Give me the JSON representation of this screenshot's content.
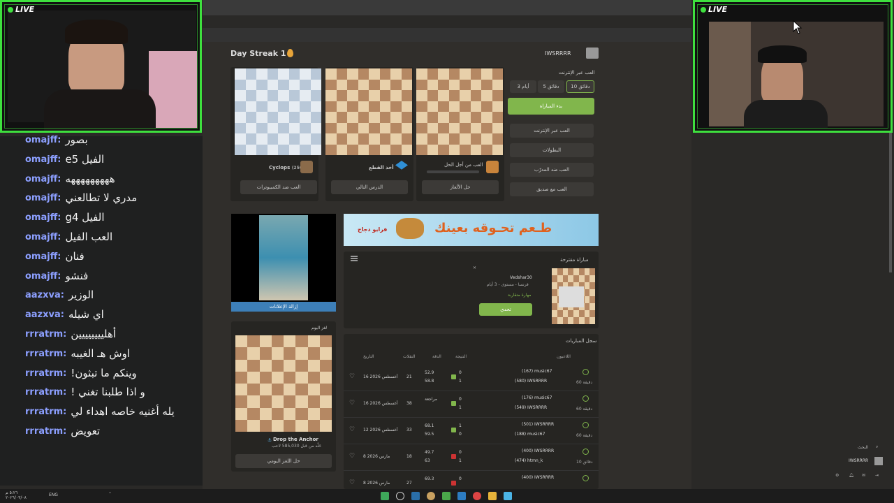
{
  "stream": {
    "live_label": "LIVE"
  },
  "chat": {
    "messages": [
      {
        "user": "omajff",
        "text": "بصور"
      },
      {
        "user": "omajff",
        "text": "e5 الفيل"
      },
      {
        "user": "omajff",
        "text": "هههههههههه"
      },
      {
        "user": "omajff",
        "text": "مدري لا تطالعني"
      },
      {
        "user": "omajff",
        "text": "g4 الفيل"
      },
      {
        "user": "omajff",
        "text": "العب الفيل"
      },
      {
        "user": "omajff",
        "text": "فنان"
      },
      {
        "user": "omajff",
        "text": "فنشو"
      },
      {
        "user": "aazxva",
        "text": "الوزير"
      },
      {
        "user": "aazxva",
        "text": "اي شيله"
      },
      {
        "user": "rrratrm",
        "text": "أهليييييييين"
      },
      {
        "user": "rrratrm",
        "text": "اوش هـ الغيبه"
      },
      {
        "user": "rrratrm",
        "text": "!وينكم ما تبثون"
      },
      {
        "user": "rrratrm",
        "text": "! و اذا طلبنا تغني"
      },
      {
        "user": "rrratrm",
        "text": "يله أغنيه خاصه اهداء لي"
      },
      {
        "user": "rrratrm",
        "text": "تعويض"
      }
    ]
  },
  "site": {
    "streak": "Day Streak 1",
    "username": "IWSRRRR",
    "play_online_title": "العب عبر الإنترنت",
    "time_options": [
      "3 أيام",
      "5 دقائق",
      "10 دقائق"
    ],
    "start_game": "بدء المباراة",
    "menu": [
      "العب عبر الإنترنت",
      "البطولات",
      "العب ضد المدرّب",
      "العب مع صديق"
    ],
    "cards": [
      {
        "title": "Cyclops",
        "rating": "(250)",
        "button": "العب ضد الكمبيوترات"
      },
      {
        "title": "أخذ القطع",
        "button": "الدرس التالي"
      },
      {
        "title": "العب من أجل الحل",
        "button": "حل الألغاز"
      }
    ],
    "ad_remove": "إزالة الإعلانات",
    "ad_text": "طـعم تحـوقه بعينك",
    "ad_brand": "فرايو دجاج",
    "suggested_title": "مباراة مقترحة",
    "suggested_player": "Vedshar30",
    "suggested_info": "فرنسا - مستوى - 3 أيام",
    "suggested_level": "مهارة متقاربة",
    "challenge": "تحدي",
    "puzzle_title": "لغز اليوم",
    "puzzle_name": "Drop the Anchor",
    "puzzle_sub": "حَلّه من قبل 585,030 لاعب",
    "puzzle_btn": "حل اللغز اليومي",
    "history_title": "سجل المباريات",
    "history_headers": [
      "اللاعبون",
      "النتيجة",
      "الدقة",
      "النقلات",
      "التاريخ"
    ],
    "games": [
      {
        "p1": "music67",
        "r1": "(167)",
        "p2": "IWSRRRR",
        "r2": "(580)",
        "s1": "0",
        "s2": "1",
        "acc1": "52.9",
        "acc2": "58.8",
        "moves": "21",
        "date": "16 أغسطس 2026",
        "mode": "60 دقيقة",
        "res": "win"
      },
      {
        "p1": "music67",
        "r1": "(176)",
        "p2": "IWSRRRR",
        "r2": "(549)",
        "s1": "0",
        "s2": "1",
        "acc1": "مراجعة",
        "acc2": "",
        "moves": "38",
        "date": "16 أغسطس 2026",
        "mode": "60 دقيقة",
        "res": "win"
      },
      {
        "p1": "IWSRRRR",
        "r1": "(501)",
        "p2": "music67",
        "r2": "(188)",
        "s1": "1",
        "s2": "0",
        "acc1": "68.1",
        "acc2": "59.5",
        "moves": "33",
        "date": "12 أغسطس 2026",
        "mode": "60 دقيقة",
        "res": "win"
      },
      {
        "p1": "IWSRRRR",
        "r1": "(400)",
        "p2": "htmn_k",
        "r2": "(474)",
        "s1": "0",
        "s2": "1",
        "acc1": "49.7",
        "acc2": "63",
        "moves": "18",
        "date": "8 مارس 2026",
        "mode": "10 دقائق",
        "res": "loss"
      },
      {
        "p1": "IWSRRRR",
        "r1": "(400)",
        "p2": "",
        "r2": "",
        "s1": "0",
        "s2": "",
        "acc1": "69.3",
        "acc2": "",
        "moves": "27",
        "date": "8 مارس 2026",
        "mode": "",
        "res": "loss"
      }
    ]
  },
  "right": {
    "search": "البحث",
    "user": "IWSRRRR"
  },
  "taskbar": {
    "lang": "ENG",
    "time": "٥:٢٦ م",
    "date": "٢٠٢٦/٠٣/٠٨"
  },
  "colors": {
    "green": "#81b64c",
    "neon": "#3ee03e",
    "chat_user": "#8c9fff"
  }
}
